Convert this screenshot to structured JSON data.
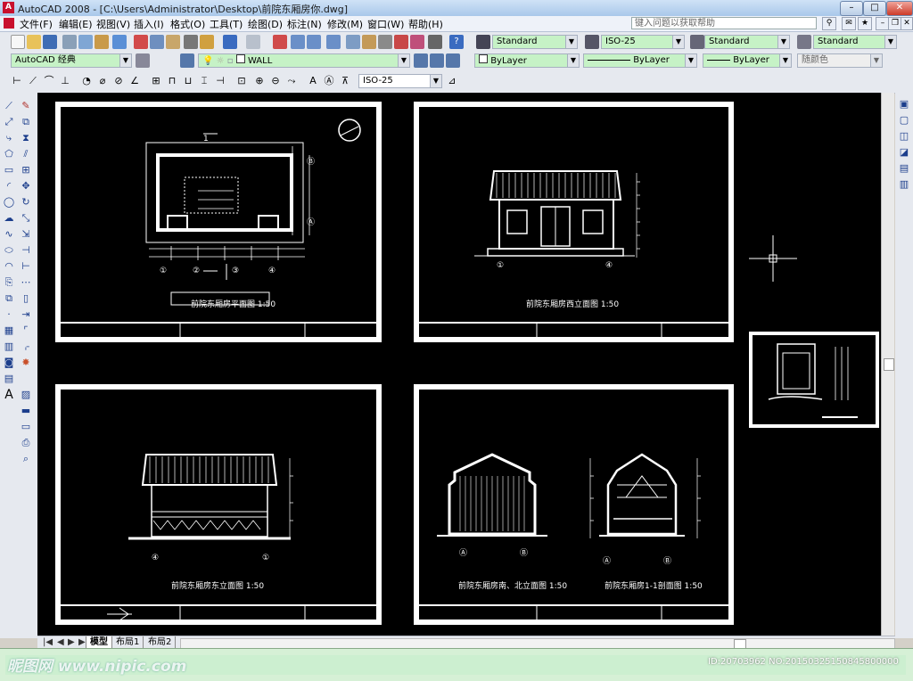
{
  "window": {
    "app_name": "AutoCAD 2008",
    "title": "AutoCAD 2008 - [C:\\Users\\Administrator\\Desktop\\前院东厢房你.dwg]",
    "minimize_glyph": "–",
    "maximize_glyph": "□",
    "close_glyph": "✕"
  },
  "menubar": {
    "items": [
      "文件(F)",
      "编辑(E)",
      "视图(V)",
      "插入(I)",
      "格式(O)",
      "工具(T)",
      "绘图(D)",
      "标注(N)",
      "修改(M)",
      "窗口(W)",
      "帮助(H)"
    ],
    "help_search_placeholder": "键入问题以获取帮助"
  },
  "styles_toolbar": {
    "text_style": "Standard",
    "dim_style": "ISO-25",
    "table_style": "Standard",
    "multileader_style": "Standard"
  },
  "workspace_toolbar": {
    "workspace": "AutoCAD 经典",
    "current_layer": "WALL",
    "color": "ByLayer",
    "linetype": "ByLayer",
    "lineweight": "ByLayer",
    "plot_style": "随颜色"
  },
  "dimension_toolbar": {
    "dim_style": "ISO-25"
  },
  "drawing": {
    "sheet_titles": [
      "前院东厢房平面图 1:50",
      "前院东厢房西立面图 1:50",
      "前院东厢房东立面图 1:50",
      "前院东厢房南、北立面图 1:50"
    ],
    "section_title": "前院东厢房1-1剖面图 1:50",
    "grid_labels": [
      "①",
      "②",
      "③",
      "④",
      "Ⓐ",
      "Ⓑ"
    ],
    "section_marker": "1"
  },
  "layout_tabs": {
    "tabs": [
      "模型",
      "布局1",
      "布局2"
    ],
    "active": "模型"
  },
  "watermark": {
    "left": "昵图网 www.nipic.com",
    "right": "ID:20703962 NO:20150325150845800000"
  },
  "colors": {
    "canvas": "#000000",
    "drawing_lines": "#ffffff",
    "layer_combo": "#c6f2c6",
    "command_area": "#d6f0d6"
  }
}
